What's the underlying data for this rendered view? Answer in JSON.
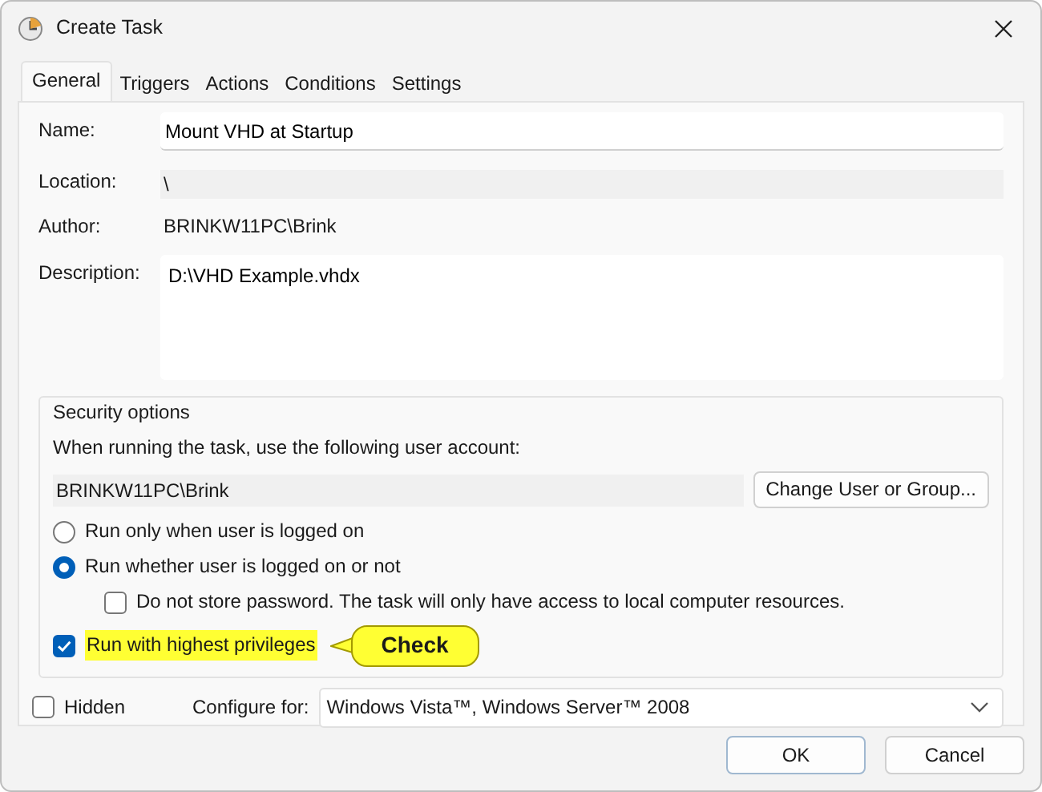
{
  "window": {
    "title": "Create Task"
  },
  "tabs": [
    {
      "label": "General",
      "selected": true
    },
    {
      "label": "Triggers",
      "selected": false
    },
    {
      "label": "Actions",
      "selected": false
    },
    {
      "label": "Conditions",
      "selected": false
    },
    {
      "label": "Settings",
      "selected": false
    }
  ],
  "fields": [
    {
      "label": "Name:",
      "value": "Mount VHD at Startup",
      "kind": "input"
    },
    {
      "label": "Location:",
      "value": "\\",
      "kind": "readonly"
    },
    {
      "label": "Author:",
      "value": "BRINKW11PC\\Brink",
      "kind": "plain"
    },
    {
      "label": "Description:",
      "value": "D:\\VHD Example.vhdx",
      "kind": "textarea"
    }
  ],
  "security": {
    "title": "Security options",
    "account_prompt": "When running the task, use the following user account:",
    "account": "BRINKW11PC\\Brink",
    "change_button": "Change User or Group...",
    "options": [
      {
        "kind": "radio",
        "label": "Run only when user is logged on",
        "checked": false
      },
      {
        "kind": "radio",
        "label": "Run whether user is logged on or not",
        "checked": true
      },
      {
        "kind": "subcheck",
        "label": "Do not store password.  The task will only have access to local computer resources.",
        "checked": false
      },
      {
        "kind": "check",
        "label": "Run with highest privileges",
        "checked": true,
        "highlighted": true
      }
    ],
    "callout": "Check"
  },
  "hidden": {
    "label": "Hidden",
    "checked": false
  },
  "configure": {
    "label": "Configure for:",
    "value": "Windows Vista™, Windows Server™ 2008"
  },
  "buttons": [
    {
      "label": "OK",
      "default": true
    },
    {
      "label": "Cancel",
      "default": false
    }
  ]
}
